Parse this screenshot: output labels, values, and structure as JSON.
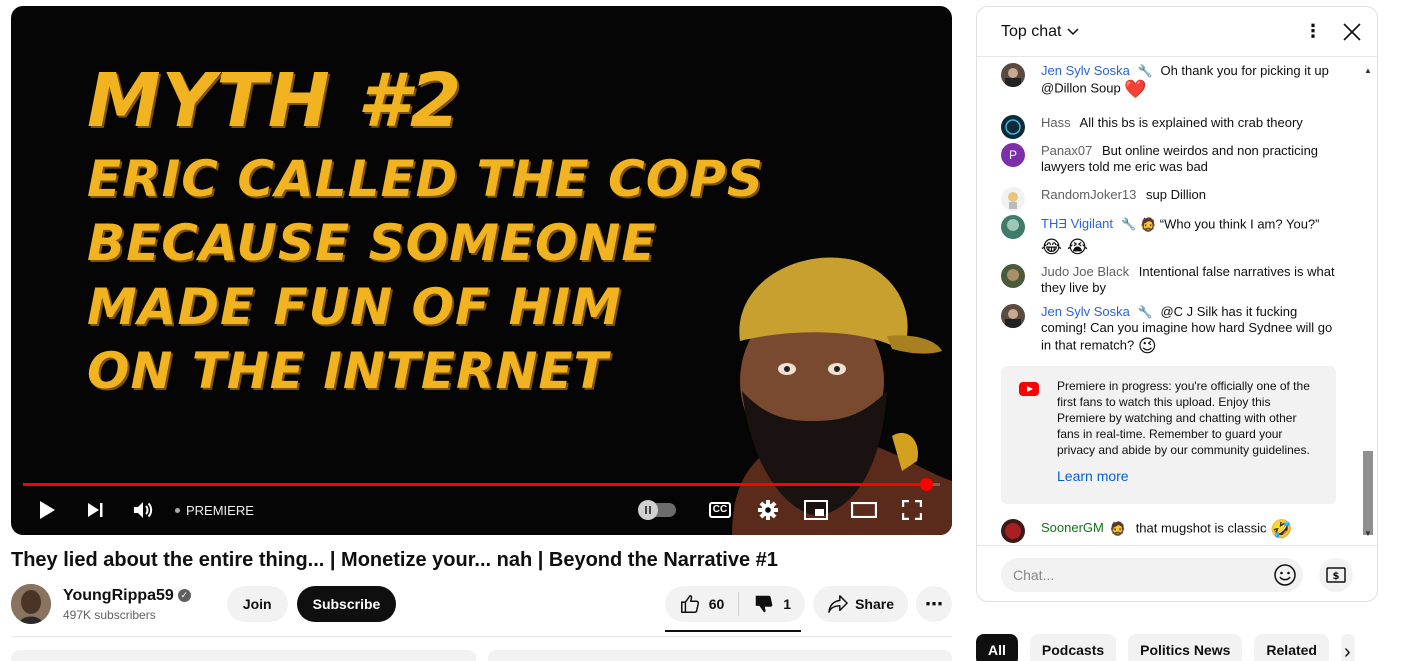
{
  "player": {
    "thumbnail_lines": [
      "MYTH #2",
      "ERIC CALLED THE COPS",
      "BECAUSE SOMEONE",
      "MADE FUN OF HIM",
      "ON THE INTERNET"
    ],
    "progress_fraction": 0.985,
    "premiere_label": "PREMIERE",
    "cc_label": "CC",
    "accent_color": "#ff0000"
  },
  "video": {
    "title": "They lied about the entire thing... | Monetize your... nah | Beyond the Narrative #1",
    "channel_name": "YoungRippa59",
    "subscribers": "497K subscribers",
    "join_label": "Join",
    "subscribe_label": "Subscribe",
    "likes": "60",
    "dislikes": "1",
    "share_label": "Share",
    "more_label": "⋯"
  },
  "chat": {
    "title": "Top chat",
    "messages": [
      {
        "author": "Jen Sylv Soska",
        "text": "Oh thank you for picking it up @Dillon Soup",
        "emoji": "❤️"
      },
      {
        "author": "Hass",
        "text": "All this bs is explained with crab theory"
      },
      {
        "author": "Panax07",
        "avatar_letter": "P",
        "text": "But online weirdos and non practicing lawyers told me eric was bad"
      },
      {
        "author": "RandomJoker13",
        "text": "sup Dillion"
      },
      {
        "author": "THƎ Vigilant",
        "text": "“Who you think I am? You?”",
        "emoji": "😂 😭"
      },
      {
        "author": "Judo Joe Black",
        "text": "Intentional false narratives is what they live by"
      },
      {
        "author": "Jen Sylv Soska",
        "text": "@C J Silk has it fucking coming! Can you imagine how hard Sydnee will go in that rematch?",
        "emoji": "😉"
      },
      {
        "author": "SoonerGM",
        "text": "that mugshot is classic",
        "emoji": "🤣"
      }
    ],
    "premiere_notice": "Premiere in progress: you're officially one of the first fans to watch this upload. Enjoy this Premiere by watching and chatting with other fans in real-time. Remember to guard your privacy and abide by our community guidelines.",
    "learn_more": "Learn more",
    "input_placeholder": "Chat..."
  },
  "chips": [
    "All",
    "Podcasts",
    "Politics News",
    "Related"
  ]
}
